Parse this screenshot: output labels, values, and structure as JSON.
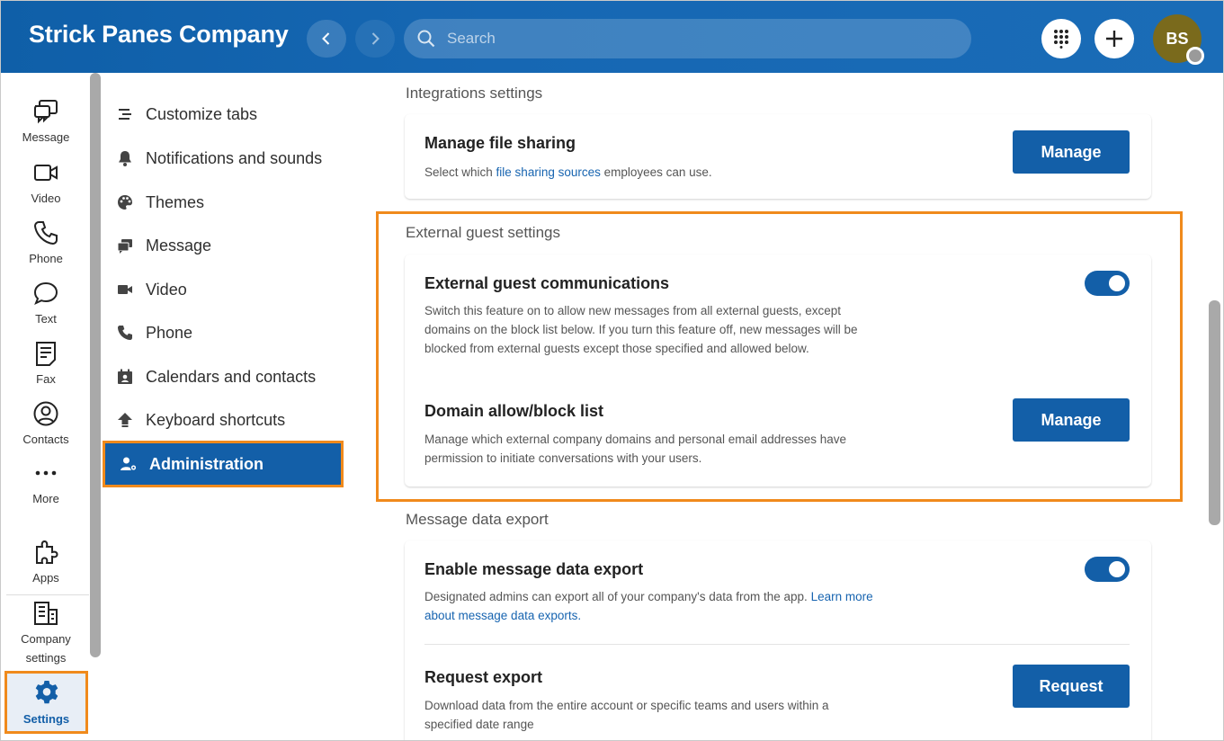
{
  "header": {
    "brand": "Strick Panes Company",
    "search_placeholder": "Search",
    "avatar_initials": "BS"
  },
  "rail": {
    "items": [
      {
        "label": "Message",
        "icon": "message-icon"
      },
      {
        "label": "Video",
        "icon": "video-icon"
      },
      {
        "label": "Phone",
        "icon": "phone-icon"
      },
      {
        "label": "Text",
        "icon": "text-bubble-icon"
      },
      {
        "label": "Fax",
        "icon": "fax-icon"
      },
      {
        "label": "Contacts",
        "icon": "contacts-icon"
      },
      {
        "label": "More",
        "icon": "more-icon"
      },
      {
        "label": "Apps",
        "icon": "puzzle-icon"
      },
      {
        "label": "Company settings",
        "icon": "building-icon"
      }
    ],
    "settings_label": "Settings"
  },
  "menu": {
    "items": [
      {
        "label": "Customize tabs",
        "icon": "customize-icon"
      },
      {
        "label": "Notifications and sounds",
        "icon": "bell-icon"
      },
      {
        "label": "Themes",
        "icon": "palette-icon"
      },
      {
        "label": "Message",
        "icon": "message-icon"
      },
      {
        "label": "Video",
        "icon": "video-icon"
      },
      {
        "label": "Phone",
        "icon": "phone-icon"
      },
      {
        "label": "Calendars and contacts",
        "icon": "calendar-contacts-icon"
      },
      {
        "label": "Keyboard shortcuts",
        "icon": "keyboard-icon"
      },
      {
        "label": "Administration",
        "icon": "admin-icon"
      }
    ],
    "active_index": 8
  },
  "main": {
    "integrations": {
      "title": "Integrations settings",
      "file_sharing": {
        "title": "Manage file sharing",
        "desc_before": "Select which ",
        "desc_link": "file sharing sources",
        "desc_after": " employees can use.",
        "button": "Manage"
      }
    },
    "external_guest": {
      "title": "External guest settings",
      "communications": {
        "title": "External guest communications",
        "desc": "Switch this feature on to allow new messages from all external guests, except domains on the block list below. If you turn this feature off, new messages will be blocked from external guests except those specified and allowed below.",
        "enabled": true
      },
      "domain_list": {
        "title": "Domain allow/block list",
        "desc": "Manage which external company domains and personal email addresses have permission to initiate conversations with your users.",
        "button": "Manage"
      }
    },
    "message_export": {
      "title": "Message data export",
      "enable": {
        "title": "Enable message data export",
        "desc_before": "Designated admins can export all of your company's data from the app. ",
        "desc_link": "Learn more about message data exports.",
        "enabled": true
      },
      "request": {
        "title": "Request export",
        "desc": "Download data from the entire account or specific teams and users within a specified date range",
        "button": "Request"
      }
    }
  },
  "colors": {
    "brand_blue": "#135fa8",
    "highlight_orange": "#f08a1c",
    "avatar_bg": "#7a6a1c"
  }
}
